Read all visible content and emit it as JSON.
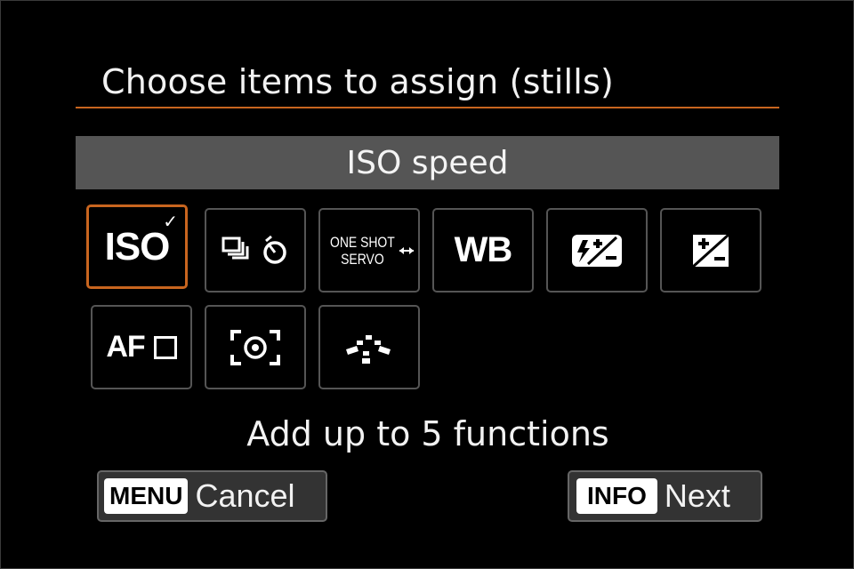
{
  "screen": {
    "title": "Choose items to assign (stills)",
    "selected_item": "ISO speed",
    "hint": "Add up to 5 functions",
    "accent_color": "#c8651f"
  },
  "items": [
    {
      "label": "ISO",
      "icon": "iso-icon",
      "selected": true,
      "checked": true
    },
    {
      "icon": "drive-mode-self-timer-icon",
      "selected": false
    },
    {
      "label_line1": "ONE SHOT",
      "label_line2": "SERVO",
      "icon": "af-operation-icon",
      "selected": false
    },
    {
      "label": "WB",
      "icon": "white-balance-icon",
      "selected": false
    },
    {
      "icon": "flash-exposure-compensation-icon",
      "selected": false
    },
    {
      "icon": "exposure-compensation-icon",
      "selected": false
    },
    {
      "label": "AF",
      "icon": "af-area-icon",
      "selected": false
    },
    {
      "icon": "metering-mode-icon",
      "selected": false
    },
    {
      "icon": "af-points-icon",
      "selected": false
    }
  ],
  "buttons": {
    "menu_key": "MENU",
    "cancel_label": "Cancel",
    "info_key": "INFO",
    "next_label": "Next"
  }
}
